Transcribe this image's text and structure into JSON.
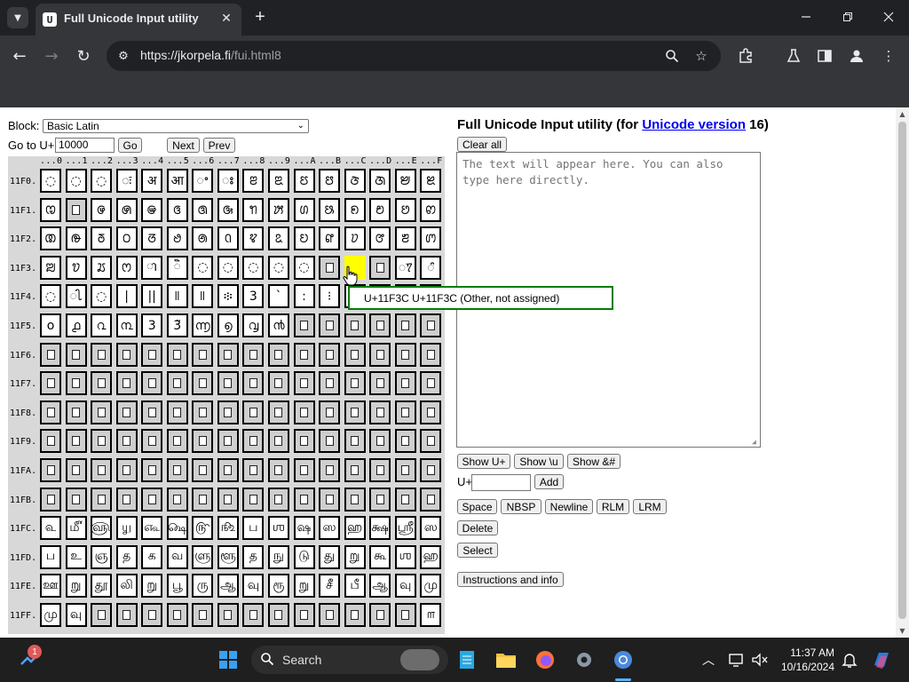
{
  "browser": {
    "tab_title": "Full Unicode Input utility",
    "tab_favicon": "favicon-icon",
    "url_host": "https://jkorpela.fi",
    "url_path": "/fui.html8"
  },
  "page": {
    "block_label": "Block:",
    "block_value": "Basic Latin",
    "goto_label": "Go to U+",
    "goto_value": "10000",
    "go_button": "Go",
    "next_button": "Next",
    "prev_button": "Prev",
    "heading_prefix": "Full Unicode Input utility (for ",
    "heading_link": "Unicode version",
    "heading_suffix": " 16)",
    "clear_button": "Clear all",
    "textarea_placeholder": "The text will appear here. You can also type here directly.",
    "show_uplus": "Show U+",
    "show_u": "Show \\u",
    "show_amp": "Show &#",
    "uplus_label": "U+",
    "add_button": "Add",
    "space_button": "Space",
    "nbsp_button": "NBSP",
    "newline_button": "Newline",
    "rlm_button": "RLM",
    "lrm_button": "LRM",
    "delete_button": "Delete",
    "select_button": "Select",
    "instructions_button": "Instructions and info",
    "tooltip": "U+11F3C U+11F3C (Other, not assigned)"
  },
  "grid": {
    "columns": [
      "...0",
      "...1",
      "...2",
      "...3",
      "...4",
      "...5",
      "...6",
      "...7",
      "...8",
      "...9",
      "...A",
      "...B",
      "...C",
      "...D",
      "...E",
      "...F"
    ],
    "highlight": {
      "row": 3,
      "col": 12
    },
    "rows": [
      {
        "label": "11F0.",
        "cells": [
          "◌",
          "◌",
          "◌",
          "◌ः",
          "अ",
          "आ",
          "ꢀ",
          "ꢁ",
          "ꢂ",
          "ꢃ",
          "ꢄ",
          "ꢅ",
          "ꢆ",
          "ꢇ",
          "ꢈ",
          "ꢉ"
        ]
      },
      {
        "label": "11F1.",
        "cells": [
          "ꢊ",
          "?",
          "ꢌ",
          "ꢍ",
          "ꢎ",
          "ꢏ",
          "ꢐ",
          "ꢑ",
          "ꢒ",
          "ꢓ",
          "ꢔ",
          "ꢕ",
          "ꢖ",
          "ꢗ",
          "ꢘ",
          "ꢙ"
        ]
      },
      {
        "label": "11F2.",
        "cells": [
          "ꢚ",
          "ꢛ",
          "ꢜ",
          "ꢝ",
          "ꢞ",
          "ꢟ",
          "ꢠ",
          "ꢡ",
          "ꢢ",
          "ꢣ",
          "ꢤ",
          "ꢥ",
          "ꢦ",
          "ꢧ",
          "ꢨ",
          "ꢩ"
        ]
      },
      {
        "label": "11F3.",
        "cells": [
          "ꢪ",
          "ꢫ",
          "ꢬ",
          "ꢭ",
          "◌ា",
          "◌ិ",
          "◌",
          "◌",
          "◌",
          "◌",
          "◌",
          "?",
          "",
          "?",
          "◌ꢵ",
          "◌ꢶ"
        ]
      },
      {
        "label": "11F4.",
        "cells": [
          "◌",
          "◌ꢷ",
          "◌",
          "|",
          "||",
          "꣏",
          "꣏",
          "፨",
          "3",
          "`",
          ":",
          "⁝",
          "",
          "",
          "",
          ""
        ]
      },
      {
        "label": "11F5.",
        "cells": [
          "o",
          "൧",
          "൨",
          "൩",
          "3",
          "3̃",
          "൬",
          "൭",
          "൮",
          "൯",
          "?",
          "?",
          "?",
          "?",
          "?",
          "?"
        ]
      },
      {
        "label": "11F6.",
        "cells": [
          "?",
          "?",
          "?",
          "?",
          "?",
          "?",
          "?",
          "?",
          "?",
          "?",
          "?",
          "?",
          "?",
          "?",
          "?",
          "?"
        ]
      },
      {
        "label": "11F7.",
        "cells": [
          "?",
          "?",
          "?",
          "?",
          "?",
          "?",
          "?",
          "?",
          "?",
          "?",
          "?",
          "?",
          "?",
          "?",
          "?",
          "?"
        ]
      },
      {
        "label": "11F8.",
        "cells": [
          "?",
          "?",
          "?",
          "?",
          "?",
          "?",
          "?",
          "?",
          "?",
          "?",
          "?",
          "?",
          "?",
          "?",
          "?",
          "?"
        ]
      },
      {
        "label": "11F9.",
        "cells": [
          "?",
          "?",
          "?",
          "?",
          "?",
          "?",
          "?",
          "?",
          "?",
          "?",
          "?",
          "?",
          "?",
          "?",
          "?",
          "?"
        ]
      },
      {
        "label": "11FA.",
        "cells": [
          "?",
          "?",
          "?",
          "?",
          "?",
          "?",
          "?",
          "?",
          "?",
          "?",
          "?",
          "?",
          "?",
          "?",
          "?",
          "?"
        ]
      },
      {
        "label": "11FB.",
        "cells": [
          "?",
          "?",
          "?",
          "?",
          "?",
          "?",
          "?",
          "?",
          "?",
          "?",
          "?",
          "?",
          "?",
          "?",
          "?",
          "?"
        ]
      },
      {
        "label": "11FC.",
        "cells": [
          "௳",
          "௴",
          "௵",
          "௶",
          "௷",
          "௸",
          "௹",
          "௺",
          "ப",
          "ஶ",
          "ஷ",
          "ஸ",
          "ஹ",
          "க்ஷ",
          "ஸ்ரீ",
          "ஸ"
        ]
      },
      {
        "label": "11FD.",
        "cells": [
          "ப",
          "உ",
          "ஞ",
          "த",
          "க",
          "வ",
          "ளு",
          "ளூ",
          "த",
          "நு",
          "டு",
          "து",
          "று",
          "கூ",
          "ஶ",
          "ஹ"
        ]
      },
      {
        "label": "11FE.",
        "cells": [
          "ஊ",
          "று",
          "தூ",
          "லி",
          "று",
          "பூ",
          "ரு",
          "ஆ",
          "வு",
          "ரூ",
          "று",
          "சீ",
          "பீ",
          "ஆ",
          "வு",
          "மு"
        ]
      },
      {
        "label": "11FF.",
        "cells": [
          "மு",
          "வு",
          "?",
          "?",
          "?",
          "?",
          "?",
          "?",
          "?",
          "?",
          "?",
          "?",
          "?",
          "?",
          "?",
          "௱"
        ]
      }
    ]
  },
  "taskbar": {
    "search_placeholder": "Search",
    "time": "11:37 AM",
    "date": "10/16/2024",
    "notification_count": "1"
  }
}
